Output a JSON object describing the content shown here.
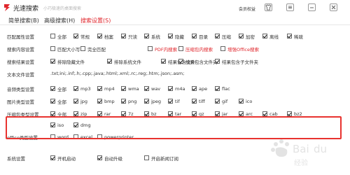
{
  "app": {
    "title": "光速搜索",
    "slogan": "小巧极速的桌面搜索",
    "member_label": "会员权益",
    "window_controls": [
      "skin",
      "menu",
      "minimize",
      "close"
    ]
  },
  "menubar": {
    "items": [
      {
        "label": "简单搜索(B)",
        "active": false
      },
      {
        "label": "高级搜索(H)",
        "active": false
      },
      {
        "label": "搜索设置(S)",
        "active": true
      }
    ]
  },
  "rows": [
    {
      "label": "匹配属性设置",
      "options": [
        {
          "text": "全部",
          "checked": false
        },
        {
          "text": "常规",
          "checked": true
        },
        {
          "text": "档案",
          "checked": true
        },
        {
          "text": "只读",
          "checked": true
        },
        {
          "text": "系统",
          "checked": true
        },
        {
          "text": "隐藏",
          "checked": true
        },
        {
          "text": "目录",
          "checked": true
        },
        {
          "text": "压缩",
          "checked": true
        },
        {
          "text": "加密",
          "checked": true
        },
        {
          "text": "离线",
          "checked": true
        },
        {
          "text": "稀疏",
          "checked": true
        }
      ]
    },
    {
      "label": "搜索内容设置",
      "options": [
        {
          "text": "匹配大小写",
          "checked": false
        },
        {
          "text": "完全匹配",
          "checked": false
        },
        {
          "text": "PDF内搜索",
          "checked": false,
          "red": true
        },
        {
          "text": "压缩包内搜索",
          "checked": false,
          "red": true
        },
        {
          "text": "增强Office搜索",
          "checked": false,
          "red": true
        }
      ]
    },
    {
      "label": "搜索结果设置",
      "options": [
        {
          "text": "排除隐藏文件",
          "checked": true
        },
        {
          "text": "排除系统文件",
          "checked": true
        },
        {
          "text": "结果包含文件",
          "checked": true
        },
        {
          "text": "结果包含文件夹",
          "checked": true
        },
        {
          "text": "结果包含子文件夹",
          "checked": true
        }
      ]
    },
    {
      "label": "文本文件设置",
      "text": ".txt;ini;.inf;.h;.cpp;.java;.html;.xml;.rc;.reg;.htm;.json;.asm;"
    },
    {
      "label": "音频类型设置",
      "options": [
        {
          "text": "全部",
          "checked": true
        },
        {
          "text": "mp3",
          "checked": true
        },
        {
          "text": "mp4",
          "checked": true
        },
        {
          "text": "wma",
          "checked": true
        },
        {
          "text": "wav",
          "checked": true
        },
        {
          "text": "m4a",
          "checked": true
        },
        {
          "text": "ape",
          "checked": true
        },
        {
          "text": "flac",
          "checked": true
        }
      ]
    },
    {
      "label": "图片类型设置",
      "options": [
        {
          "text": "全部",
          "checked": true
        },
        {
          "text": "jpg",
          "checked": true
        },
        {
          "text": "bmp",
          "checked": true
        },
        {
          "text": "png",
          "checked": true
        },
        {
          "text": "jpeg",
          "checked": true
        },
        {
          "text": "tif",
          "checked": true
        },
        {
          "text": "tiff",
          "checked": true
        },
        {
          "text": "gif",
          "checked": true
        },
        {
          "text": "ico",
          "checked": true
        }
      ]
    },
    {
      "label": "压缩包类型设置",
      "options": [
        {
          "text": "全部",
          "checked": true
        },
        {
          "text": "zip",
          "checked": true
        },
        {
          "text": "rar",
          "checked": true
        },
        {
          "text": "7z",
          "checked": true
        },
        {
          "text": "bz",
          "checked": true
        },
        {
          "text": "tar",
          "checked": true
        },
        {
          "text": "gz",
          "checked": true
        },
        {
          "text": "jar",
          "checked": true
        },
        {
          "text": "arc",
          "checked": true
        },
        {
          "text": "cab",
          "checked": true
        },
        {
          "text": "bz2",
          "checked": true
        }
      ]
    },
    {
      "label": "",
      "options": [
        {
          "text": "iso",
          "checked": true
        },
        {
          "text": "dmg",
          "checked": true
        }
      ]
    },
    {
      "label": "office类型设置",
      "options": [
        {
          "text": "word",
          "checked": false
        },
        {
          "text": "excel",
          "checked": false
        },
        {
          "text": "powerprinter",
          "checked": false
        }
      ]
    },
    {
      "label": "系统设置",
      "options": [
        {
          "text": "开机启动",
          "checked": true
        },
        {
          "text": "自动升级",
          "checked": true
        },
        {
          "text": "开启新闻订阅",
          "checked": false
        }
      ]
    }
  ],
  "watermark": "Baidu经验"
}
